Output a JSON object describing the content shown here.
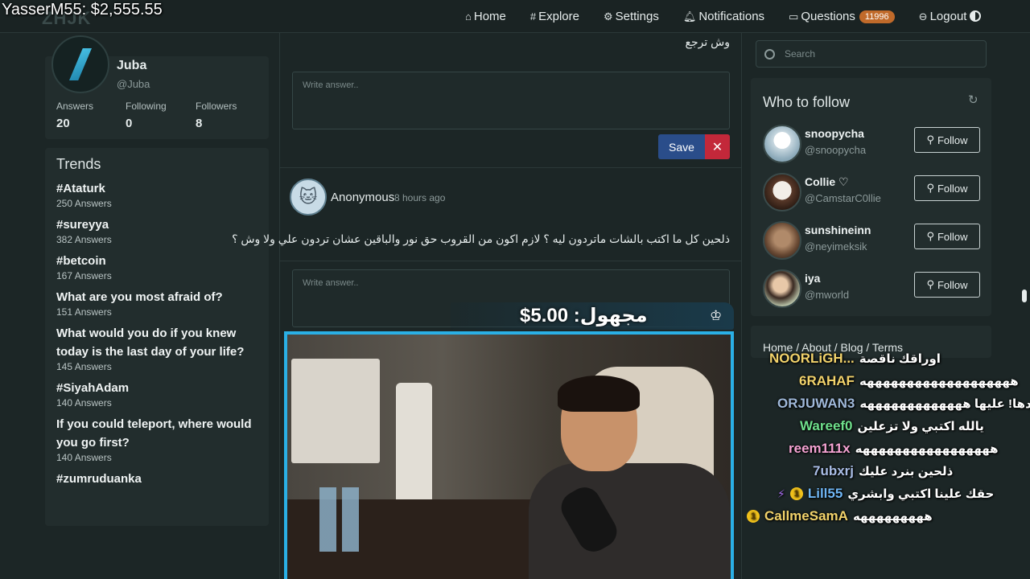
{
  "overlay": {
    "donation_title": "YasserM55: $2,555.55"
  },
  "logo": "ZHJK",
  "nav": {
    "home": "Home",
    "explore": "Explore",
    "settings": "Settings",
    "notifications": "Notifications",
    "questions": "Questions",
    "questions_count": "11996",
    "logout": "Logout"
  },
  "profile": {
    "name": "Juba",
    "handle": "@Juba",
    "answers_label": "Answers",
    "answers": "20",
    "following_label": "Following",
    "following": "0",
    "followers_label": "Followers",
    "followers": "8"
  },
  "trends": {
    "title": "Trends",
    "items": [
      {
        "tag": "#Ataturk",
        "count": "250 Answers"
      },
      {
        "tag": "#sureyya",
        "count": "382 Answers"
      },
      {
        "tag": "#betcoin",
        "count": "167 Answers"
      },
      {
        "tag": "What are you most afraid of?",
        "count": "151 Answers"
      },
      {
        "tag": "What would you do if you knew today is the last day of your life?",
        "count": "145 Answers"
      },
      {
        "tag": "#SiyahAdam",
        "count": "140 Answers"
      },
      {
        "tag": "If you could teleport, where would you go first?",
        "count": "140 Answers"
      },
      {
        "tag": "#zumruduanka",
        "count": ""
      }
    ]
  },
  "feed": {
    "question1": "وش ترجع",
    "answer_placeholder": "Write answer..",
    "save_label": "Save",
    "cancel_label": "✕",
    "post2": {
      "author": "Anonymous",
      "time": "8 hours ago",
      "question": "ذلحين كل ما اكتب بالشات ماتردون ليه ؟ لازم اكون من القروب حق نور والباقين عشان تردون علي ولا وش ؟"
    }
  },
  "search": {
    "placeholder": "Search"
  },
  "who_to_follow": {
    "title": "Who to follow",
    "follow_label": "Follow",
    "users": [
      {
        "name": "snoopycha",
        "handle": "@snoopycha"
      },
      {
        "name": "Collie ♡",
        "handle": "@CamstarC0llie"
      },
      {
        "name": "sunshineinn",
        "handle": "@neyimeksik"
      },
      {
        "name": "iya",
        "handle": "@mworld"
      }
    ]
  },
  "footer": {
    "links": "Home / About / Blog / Terms"
  },
  "donation": {
    "text": "مجهول: 5.00$"
  },
  "chat": [
    {
      "user": "NOORLiGH...",
      "msg": "اوراقك ناقصة",
      "color": "#f2d36b"
    },
    {
      "user": "6RAHAF",
      "msg": "هههههههههههههههههههه",
      "color": "#f2d36b"
    },
    {
      "user": "ORJUWAN3",
      "msg": "طيب ردها! عليها هههههههههههههه",
      "color": "#9fb8d9"
    },
    {
      "user": "Wareef0",
      "msg": "يالله اكتبي ولا تزعلين",
      "color": "#6fe08c"
    },
    {
      "user": "reem111x",
      "msg": "هههههههههههههههههه",
      "color": "#f5a3d3"
    },
    {
      "user": "7ubxrj",
      "msg": "ذلحين بنرد عليك",
      "color": "#a9bde6"
    },
    {
      "user": "Lill55",
      "msg": "حقك علينا اكتبي وابشري",
      "color": "#6fb6f5"
    },
    {
      "user": "CallmeSamA",
      "msg": "هههههههههه",
      "color": "#f2d36b"
    }
  ],
  "chat_badges": {
    "coin": "1"
  }
}
